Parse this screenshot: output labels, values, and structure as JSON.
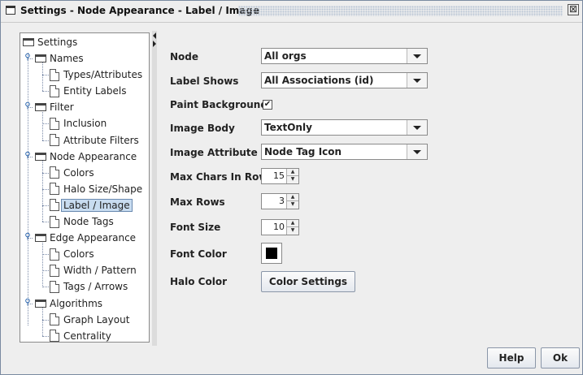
{
  "window": {
    "title": "Settings - Node Appearance - Label / Image",
    "close_glyph": "⊠"
  },
  "tree": {
    "root": "Settings",
    "items": [
      {
        "label": "Names",
        "type": "folder",
        "level": 1
      },
      {
        "label": "Types/Attributes",
        "type": "page",
        "level": 2
      },
      {
        "label": "Entity Labels",
        "type": "page",
        "level": 2
      },
      {
        "label": "Filter",
        "type": "folder",
        "level": 1
      },
      {
        "label": "Inclusion",
        "type": "page",
        "level": 2
      },
      {
        "label": "Attribute Filters",
        "type": "page",
        "level": 2
      },
      {
        "label": "Node Appearance",
        "type": "folder",
        "level": 1
      },
      {
        "label": "Colors",
        "type": "page",
        "level": 2
      },
      {
        "label": "Halo Size/Shape",
        "type": "page",
        "level": 2
      },
      {
        "label": "Label / Image",
        "type": "page",
        "level": 2,
        "selected": true
      },
      {
        "label": "Node Tags",
        "type": "page",
        "level": 2
      },
      {
        "label": "Edge Appearance",
        "type": "folder",
        "level": 1
      },
      {
        "label": "Colors",
        "type": "page",
        "level": 2
      },
      {
        "label": "Width / Pattern",
        "type": "page",
        "level": 2
      },
      {
        "label": "Tags / Arrows",
        "type": "page",
        "level": 2
      },
      {
        "label": "Algorithms",
        "type": "folder",
        "level": 1
      },
      {
        "label": "Graph Layout",
        "type": "page",
        "level": 2
      },
      {
        "label": "Centrality",
        "type": "page",
        "level": 2
      }
    ]
  },
  "form": {
    "node": {
      "label": "Node",
      "value": "All orgs"
    },
    "label_shows": {
      "label": "Label Shows",
      "value": "All Associations (id)"
    },
    "paint_background": {
      "label": "Paint Background",
      "checked": true,
      "check_glyph": "✔"
    },
    "image_body": {
      "label": "Image Body",
      "value": "TextOnly"
    },
    "image_attribute": {
      "label": "Image Attribute",
      "value": "Node Tag Icon"
    },
    "max_chars_in_row": {
      "label": "Max Chars In Row",
      "value": "15"
    },
    "max_rows": {
      "label": "Max Rows",
      "value": "3"
    },
    "font_size": {
      "label": "Font Size",
      "value": "10"
    },
    "font_color": {
      "label": "Font Color",
      "color": "#000000"
    },
    "halo_color": {
      "label": "Halo Color",
      "button_label": "Color Settings"
    }
  },
  "footer": {
    "help_label": "Help",
    "ok_label": "Ok"
  }
}
